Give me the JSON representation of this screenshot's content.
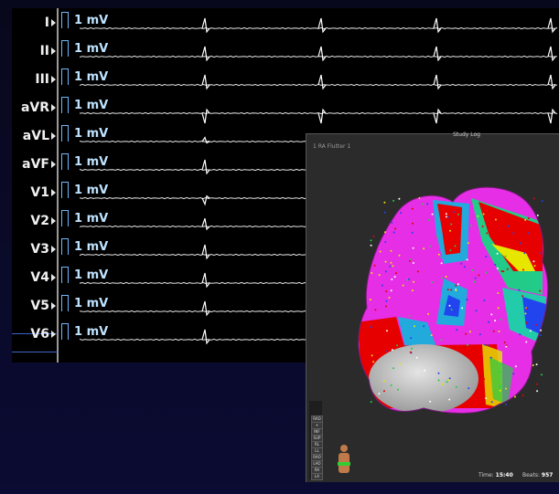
{
  "ecg": {
    "leads": [
      "I",
      "II",
      "III",
      "aVR",
      "aVL",
      "aVF",
      "V1",
      "V2",
      "V3",
      "V4",
      "V5",
      "V6"
    ],
    "calibration": "1 mV",
    "selected_lead": "V6"
  },
  "map": {
    "title": "1 RA Flutter 1",
    "top_tab": "Study Log",
    "time_label": "Time:",
    "time_value": "15:40",
    "beats_label": "Beats:",
    "beats_value": "957",
    "toolbar": [
      "RAO",
      "+",
      "INF",
      "SUP",
      "RL",
      "LL",
      "RAO",
      "LAO",
      "RA",
      "LA"
    ],
    "colors": {
      "magenta": "#e62ee6",
      "red": "#e60000",
      "yellow": "#e6e600",
      "green": "#22cc44",
      "cyan": "#22cccc",
      "blue": "#2244ee",
      "gray": "#bdbdbd"
    }
  }
}
